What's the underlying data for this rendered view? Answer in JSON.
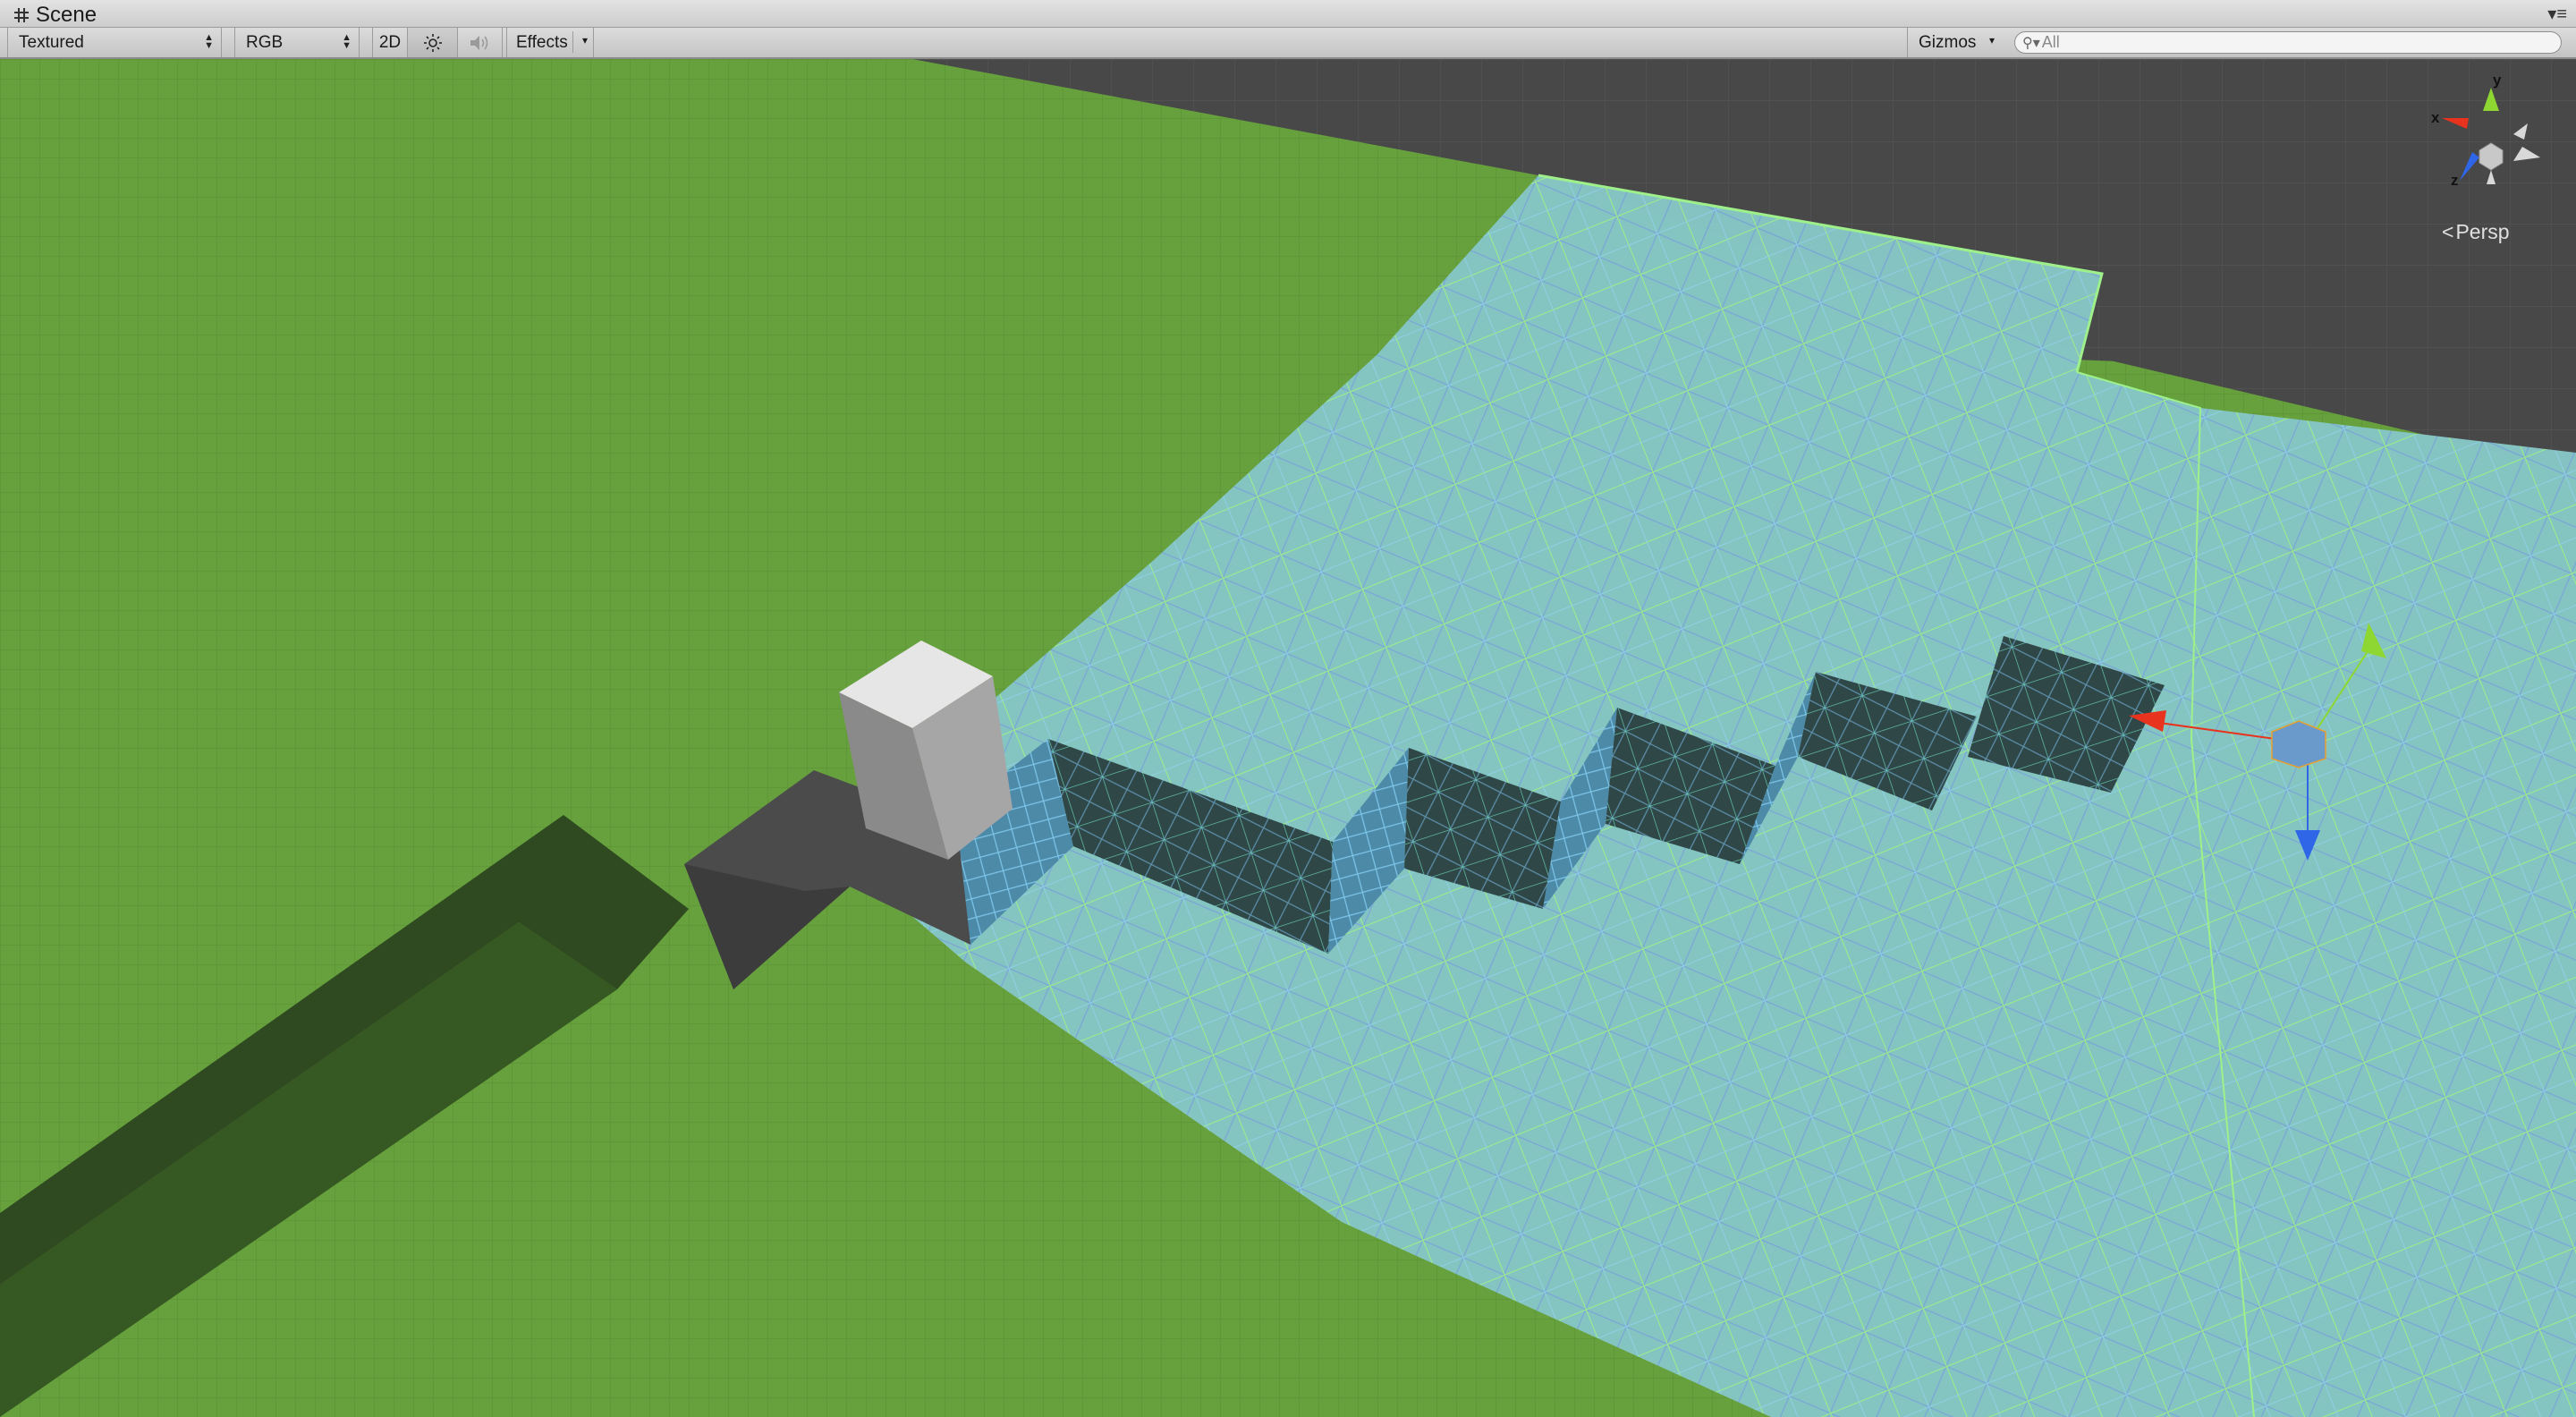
{
  "tab": {
    "title": "Scene",
    "icon": "grid-icon"
  },
  "toolbar": {
    "draw_mode": "Textured",
    "render_mode": "RGB",
    "two_d_label": "2D",
    "effects_label": "Effects",
    "gizmos_label": "Gizmos",
    "search_placeholder": "All"
  },
  "orientation_gizmo": {
    "x_label": "x",
    "y_label": "y",
    "z_label": "z",
    "projection_label": "Persp",
    "colors": {
      "x": "#e8331e",
      "y": "#8ed632",
      "z": "#2f66e8"
    }
  },
  "colors": {
    "ground": "#67a13e",
    "navmesh": "#86c6c6",
    "grid_background": "#484848"
  }
}
